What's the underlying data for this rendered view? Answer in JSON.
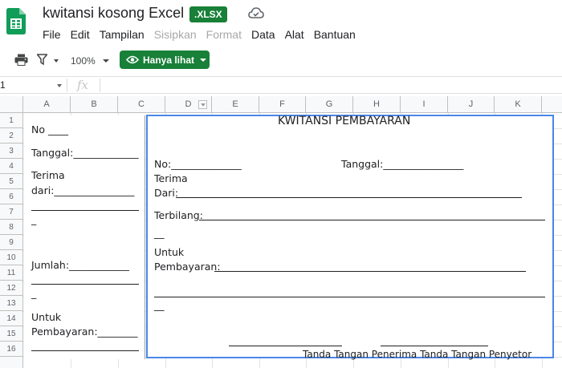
{
  "header": {
    "title": "kwitansi kosong Excel",
    "badge": ".XLSX",
    "logo_icon": "sheets-logo-icon",
    "cloud_icon": "cloud-saved-icon"
  },
  "menu": {
    "items": [
      {
        "label": "File",
        "enabled": true
      },
      {
        "label": "Edit",
        "enabled": true
      },
      {
        "label": "Tampilan",
        "enabled": true
      },
      {
        "label": "Sisipkan",
        "enabled": false
      },
      {
        "label": "Format",
        "enabled": false
      },
      {
        "label": "Data",
        "enabled": true
      },
      {
        "label": "Alat",
        "enabled": true
      },
      {
        "label": "Bantuan",
        "enabled": true
      }
    ]
  },
  "toolbar": {
    "print_icon": "print-icon",
    "filter_icon": "filter-icon",
    "zoom": "100%",
    "view_mode": "Hanya lihat",
    "view_icon": "eye-icon"
  },
  "formula_bar": {
    "name_box": "1",
    "fx_symbol": "fx"
  },
  "grid": {
    "columns": [
      "A",
      "B",
      "C",
      "D",
      "E",
      "F",
      "G",
      "H",
      "I",
      "J",
      "K"
    ],
    "rows": [
      "1",
      "2",
      "3",
      "4",
      "5",
      "6",
      "7",
      "8",
      "9",
      "10",
      "11",
      "12",
      "13",
      "14",
      "15",
      "16"
    ]
  },
  "receipt_stub": {
    "no": "No ____",
    "tanggal": "Tanggal:_____________",
    "terima": "Terima",
    "dari": "dari:________________",
    "dash1": "_",
    "jumlah": "Jumlah:____________",
    "dash2": "_",
    "untuk": "Untuk",
    "pembayaran": "Pembayaran:________"
  },
  "receipt_main": {
    "title": "KWITANSI PEMBAYARAN",
    "no": "No:______________",
    "tanggal": "Tanggal:________________",
    "terima": "Terima",
    "dari": "Dari:",
    "terbilang": "Terbilang:",
    "dash1": "__",
    "untuk": "Untuk",
    "pembayaran": "Pembayaran:",
    "dash2": "__",
    "signatures": "Tanda Tangan Penerima Tanda Tangan Penyetor"
  }
}
